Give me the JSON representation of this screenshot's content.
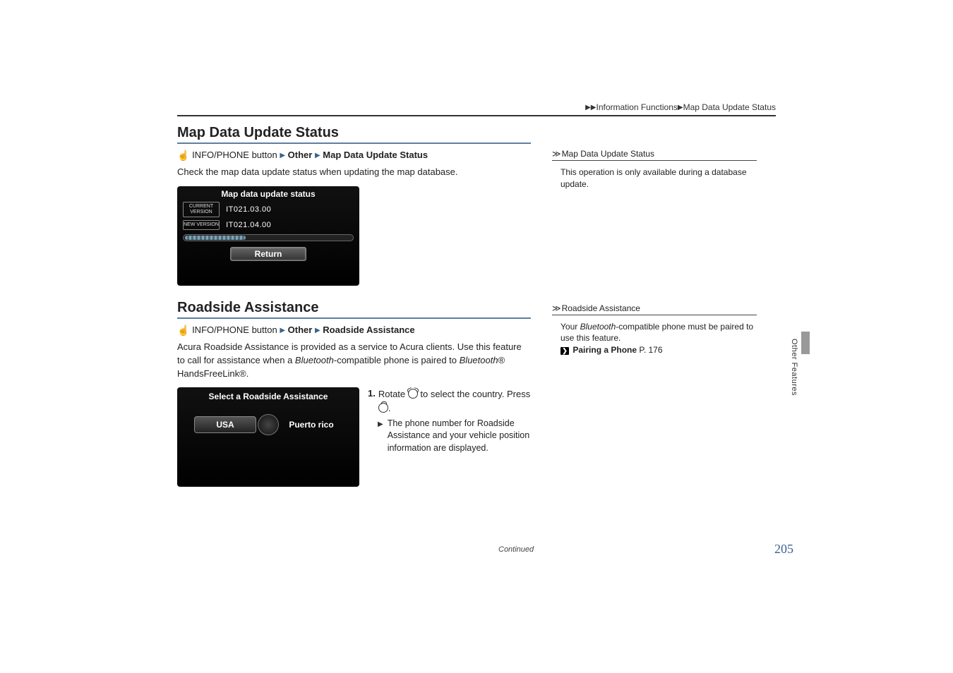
{
  "breadcrumb": {
    "level1": "",
    "level2": "Information Functions",
    "level3": "Map Data Update Status"
  },
  "section1": {
    "title": "Map Data Update Status",
    "path_button": "INFO/PHONE button",
    "path_other": "Other",
    "path_leaf": "Map Data Update Status",
    "body": "Check the map data update status when updating the map database.",
    "screen": {
      "title": "Map data update status",
      "current_label": "CURRENT VERSION",
      "current_value": "IT021.03.00",
      "new_label": "NEW VERSION",
      "new_value": "IT021.04.00",
      "return": "Return"
    }
  },
  "section2": {
    "title": "Roadside Assistance",
    "path_button": "INFO/PHONE button",
    "path_other": "Other",
    "path_leaf": "Roadside Assistance",
    "body_a": "Acura Roadside Assistance is provided as a service to Acura clients. Use this feature to call for assistance when a ",
    "body_b_italic": "Bluetooth",
    "body_c": "-compatible phone is paired to ",
    "body_d_italic": "Bluetooth",
    "body_e": "® HandsFreeLink®.",
    "screen": {
      "title": "Select a Roadside Assistance",
      "opt1": "USA",
      "opt2": "Puerto rico"
    },
    "step1_a": "Rotate ",
    "step1_b": " to select the country. Press ",
    "step1_c": ".",
    "sub1": "The phone number for Roadside Assistance and your vehicle position information are displayed."
  },
  "note1": {
    "title": "Map Data Update Status",
    "body": "This operation is only available during a database update."
  },
  "note2": {
    "title": "Roadside Assistance",
    "body_a": "Your ",
    "body_b_italic": "Bluetooth",
    "body_c": "-compatible phone must be paired to use this feature.",
    "link_label": "Pairing a Phone",
    "link_page": "P. 176"
  },
  "side_tab": "Other Features",
  "continued": "Continued",
  "page_num": "205"
}
